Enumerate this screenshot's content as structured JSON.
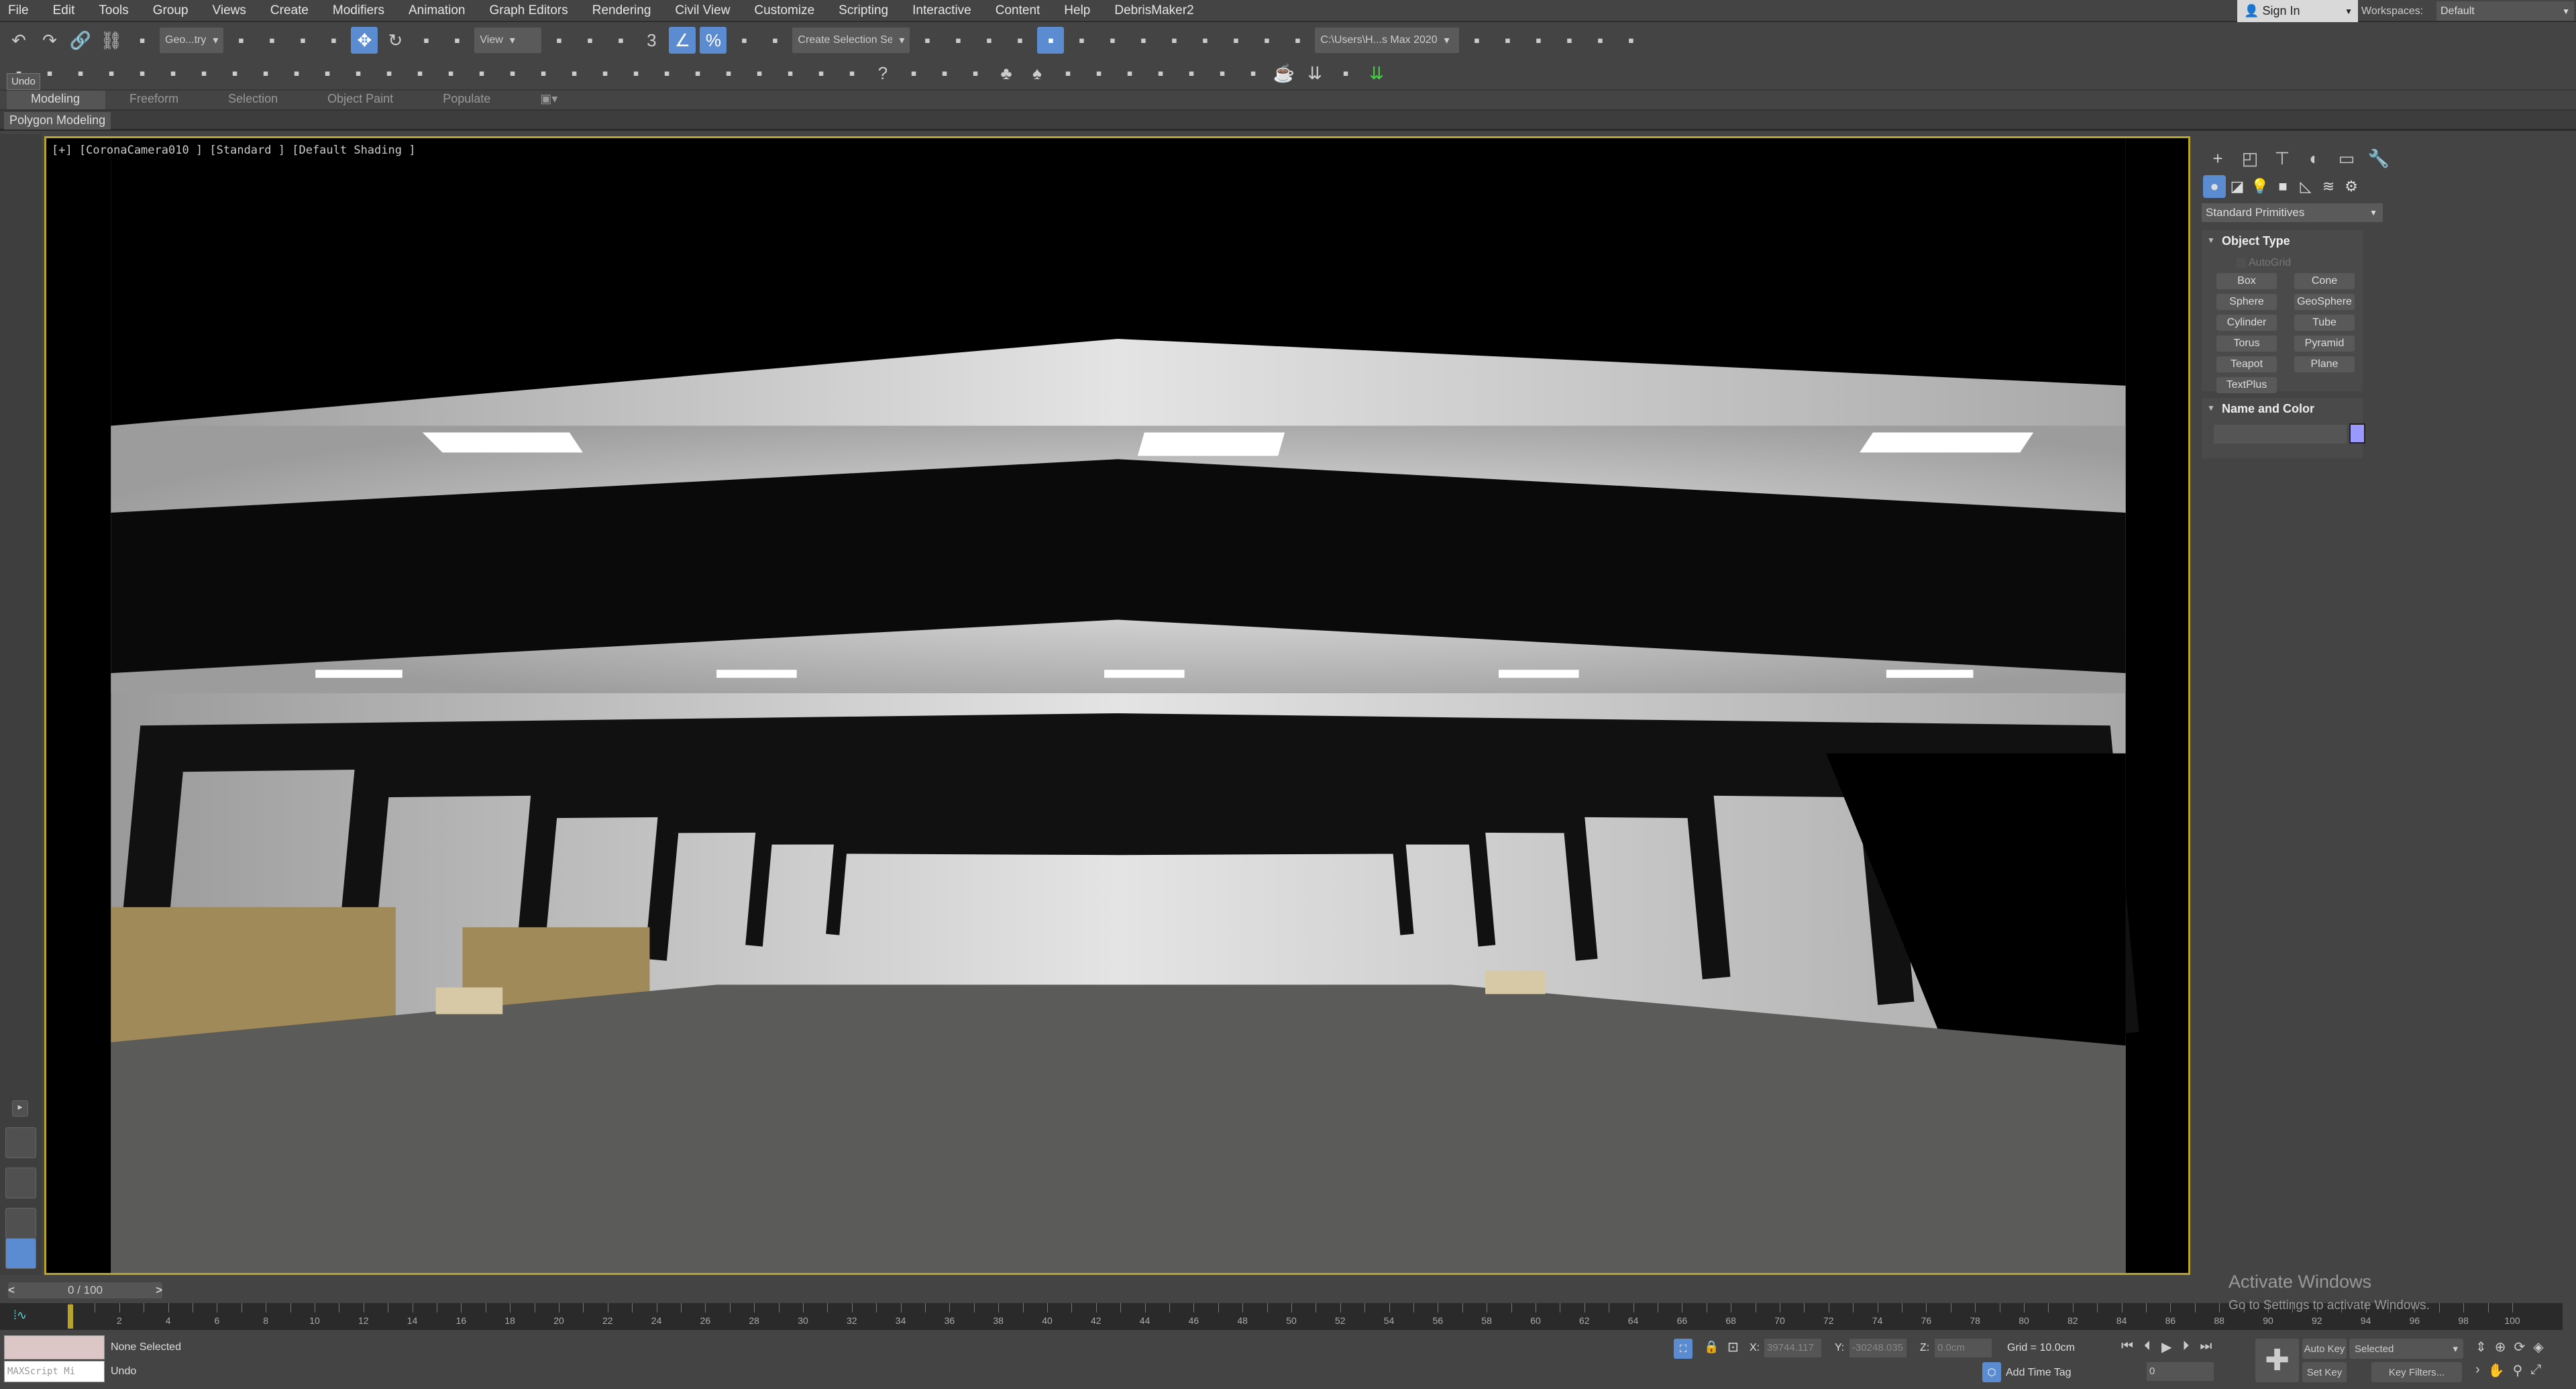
{
  "menu": [
    "File",
    "Edit",
    "Tools",
    "Group",
    "Views",
    "Create",
    "Modifiers",
    "Animation",
    "Graph Editors",
    "Rendering",
    "Civil View",
    "Customize",
    "Scripting",
    "Interactive",
    "Content",
    "Help",
    "DebrisMaker2"
  ],
  "account": {
    "sign_in": "Sign In",
    "workspaces_label": "Workspaces:",
    "workspace": "Default"
  },
  "toolbar1": {
    "icons_a": [
      "undo-icon",
      "redo-icon",
      "link-icon",
      "unlink-icon",
      "bind-space-warp-icon"
    ],
    "selection_filter": "Geo...try",
    "icons_b": [
      "select-object-icon",
      "select-by-name-icon",
      "rectangular-selection-icon",
      "window-crossing-icon",
      "select-move-icon",
      "select-rotate-icon",
      "select-scale-icon",
      "select-place-icon"
    ],
    "ref_coord": "View",
    "icons_c": [
      "pivot-center-icon",
      "select-manipulate-icon",
      "keyboard-shortcut-icon",
      "snaps-toggle-icon",
      "angle-snap-icon",
      "percent-snap-icon",
      "spinner-snap-icon",
      "edit-named-selection-icon"
    ],
    "named_selection": "Create Selection Se",
    "icons_d": [
      "mirror-icon",
      "align-icon",
      "scene-explorer-icon",
      "layer-explorer-icon",
      "ribbon-toggle-icon",
      "curve-editor-icon",
      "schematic-view-icon",
      "material-editor-icon",
      "render-setup-icon",
      "rendered-frame-window-icon",
      "render-production-icon",
      "render-iterative-icon",
      "render-cloud-icon"
    ],
    "project_path": "C:\\Users\\H...s Max 2020",
    "icons_e": [
      "project-folder-icon",
      "open-folder-icon",
      "project-settings-icon",
      "project-structure-icon",
      "paint-brush-icon",
      "add-brush-icon"
    ]
  },
  "toolbar2": {
    "icons": [
      "corona-render-icon",
      "corona-interactive-icon",
      "corona-vfb-icon",
      "corona-settings-icon",
      "corona-material-icon",
      "corona-light-icon",
      "corona-camera-icon",
      "corona-sun-icon",
      "corona-proxy-icon",
      "corona-scatter-icon",
      "corona-box-icon",
      "corona-sphere-icon",
      "corona-cylinder-icon",
      "corona-decal-icon",
      "corona-sky-icon",
      "corona-slicer-icon",
      "corona-volume-icon",
      "corona-distance-icon",
      "corona-pattern-icon",
      "corona-displacement-icon",
      "corona-chaos-scatter-icon",
      "corona-grass-icon",
      "corona-hair-icon",
      "corona-ao-icon",
      "corona-sphere-gloss-icon",
      "corona-converter-icon",
      "corona-lightmix-icon",
      "corona-layer-icon",
      "help-icon",
      "light-bulb-icon",
      "sun-positioner-icon",
      "camera-target-icon",
      "tree-icon",
      "forest-icon",
      "forest-pack-icon",
      "railclone-icon",
      "rotate-icon",
      "material-viewer-icon",
      "play-frame-icon",
      "camera-add-icon",
      "frame-window-icon",
      "teapot-icon",
      "double-chevron-icon",
      "pin-icon",
      "double-chevron-green-icon"
    ]
  },
  "tooltip": "Undo",
  "ribbon": {
    "tabs": [
      "Modeling",
      "Freeform",
      "Selection",
      "Object Paint",
      "Populate"
    ],
    "active": "Modeling",
    "panel": "Polygon Modeling"
  },
  "viewport": {
    "label": "[+] [CoronaCamera010 ] [Standard ] [Default Shading ]"
  },
  "command_panel": {
    "tabs": [
      "create-icon",
      "modify-icon",
      "hierarchy-icon",
      "motion-icon",
      "display-icon",
      "utilities-icon"
    ],
    "subtabs": [
      "geometry-icon",
      "shapes-icon",
      "lights-icon",
      "cameras-icon",
      "helpers-icon",
      "space-warps-icon",
      "systems-icon"
    ],
    "category": "Standard Primitives",
    "object_type": {
      "title": "Object Type",
      "autogrid": "AutoGrid",
      "buttons": [
        "Box",
        "Cone",
        "Sphere",
        "GeoSphere",
        "Cylinder",
        "Tube",
        "Torus",
        "Pyramid",
        "Teapot",
        "Plane",
        "TextPlus"
      ]
    },
    "name_color": {
      "title": "Name and Color",
      "name": "",
      "color": "#9999ff"
    }
  },
  "timeline": {
    "frame": "0 / 100",
    "start": 0,
    "end": 100,
    "label_step": 2,
    "current": 0
  },
  "status": {
    "maxscript": "MAXScript Mi",
    "selection": "None Selected",
    "prompt": "Undo",
    "x_label": "X:",
    "x": "39744.117",
    "y_label": "Y:",
    "y": "-30248.035",
    "z_label": "Z:",
    "z": "0.0cm",
    "grid": "Grid = 10.0cm",
    "add_time_tag": "Add Time Tag",
    "auto_key": "Auto Key",
    "set_key": "Set Key",
    "key_mode": "Selected",
    "key_filters": "Key Filters...",
    "current_frame": "0"
  },
  "watermark": {
    "title": "Activate Windows",
    "subtitle": "Go to Settings to activate Windows."
  }
}
